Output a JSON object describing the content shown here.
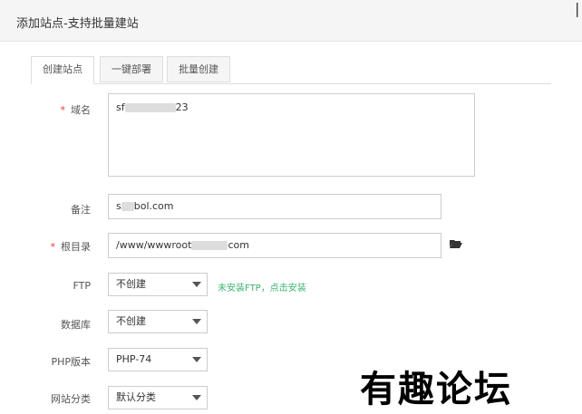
{
  "dialog": {
    "title": "添加站点-支持批量建站",
    "close_glyph": "❘"
  },
  "tabs": [
    {
      "label": "创建站点",
      "active": true
    },
    {
      "label": "一键部署",
      "active": false
    },
    {
      "label": "批量创建",
      "active": false
    }
  ],
  "form": {
    "domain": {
      "label": "域名",
      "required_mark": "*",
      "value_prefix": "sf",
      "value_suffix": "23"
    },
    "remark": {
      "label": "备注",
      "value_prefix": "s",
      "value_suffix": "bol.com"
    },
    "root": {
      "label": "根目录",
      "required_mark": "*",
      "value_prefix": "/www/wwwroot",
      "value_suffix": "com"
    },
    "ftp": {
      "label": "FTP",
      "selected": "不创建",
      "hint": "未安装FTP，点击安装"
    },
    "database": {
      "label": "数据库",
      "selected": "不创建"
    },
    "php": {
      "label": "PHP版本",
      "selected": "PHP-74"
    },
    "category": {
      "label": "网站分类",
      "selected": "默认分类"
    }
  },
  "watermark": {
    "text": "有趣论坛"
  },
  "icons": {
    "folder": "folder-open-icon"
  }
}
